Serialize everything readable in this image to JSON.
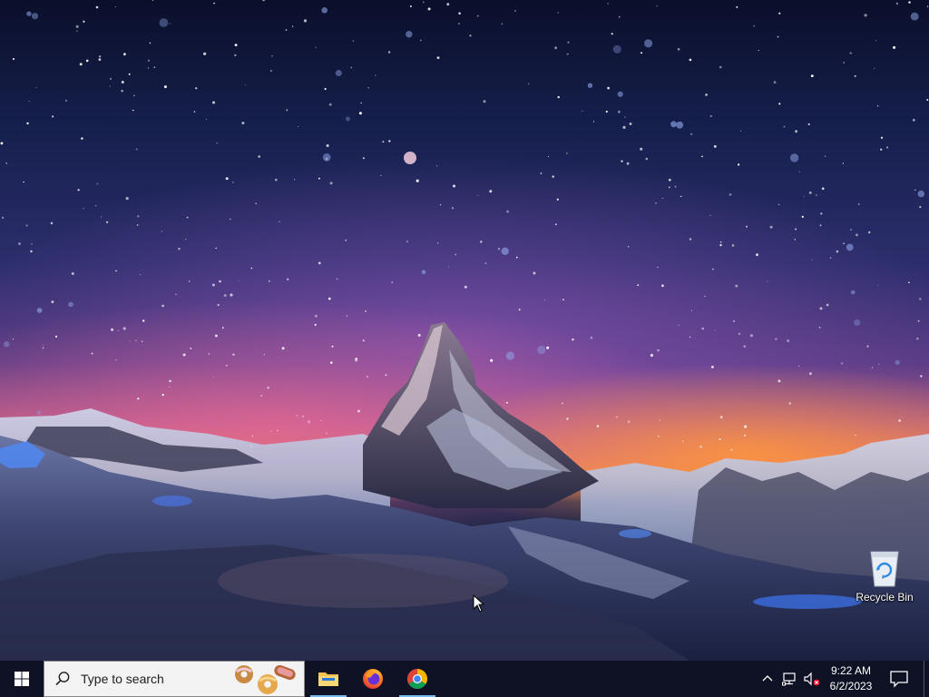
{
  "desktop": {
    "wallpaper": "starry-night-mountain",
    "icons": [
      {
        "label": "Recycle Bin",
        "icon": "recycle-bin-icon"
      }
    ]
  },
  "taskbar": {
    "start_icon": "windows-logo-icon",
    "search": {
      "placeholder": "Type to search",
      "icon": "search-icon",
      "highlight_icon": "search-highlight-donuts-icon"
    },
    "pinned_apps": [
      {
        "name": "File Explorer",
        "icon": "file-explorer-icon",
        "active": true
      },
      {
        "name": "Firefox",
        "icon": "firefox-icon",
        "active": false
      },
      {
        "name": "Google Chrome",
        "icon": "chrome-icon",
        "active": true
      }
    ],
    "tray": {
      "chevron_icon": "chevron-up-icon",
      "network_icon": "network-icon",
      "volume_icon": "volume-muted-icon",
      "time": "9:22 AM",
      "date": "6/2/2023",
      "action_center_icon": "notification-icon"
    },
    "accent_color": "#76b9ed",
    "background_color": "#0e1224"
  }
}
